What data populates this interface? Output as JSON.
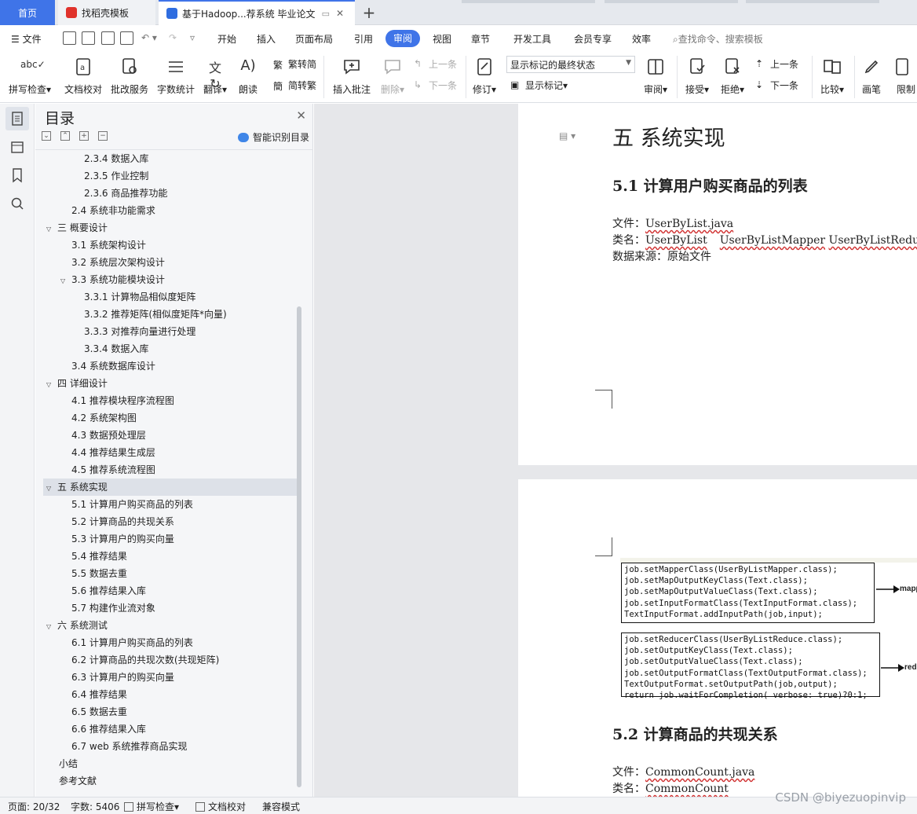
{
  "tabs": [
    {
      "label": "首页"
    },
    {
      "label": "找稻壳模板"
    },
    {
      "label": "基于Hadoop...荐系统 毕业论文"
    }
  ],
  "menu": {
    "file": "文件",
    "items": [
      "开始",
      "插入",
      "页面布局",
      "引用",
      "审阅",
      "视图",
      "章节",
      "开发工具",
      "会员专享",
      "效率"
    ],
    "active": "审阅",
    "search_placeholder": "查找命令、搜索模板"
  },
  "ribbon": {
    "spell": "拼写检查",
    "proof": "文档校对",
    "batch": "批改服务",
    "wordcount": "字数统计",
    "translate": "翻译",
    "read": "朗读",
    "trad": "繁转简",
    "simp": "简转繁",
    "comment": "插入批注",
    "delete": "删除",
    "prev_comment": "上一条",
    "next_comment": "下一条",
    "revise": "修订",
    "markup_state": "显示标记的最终状态",
    "show_markup": "显示标记",
    "review": "审阅",
    "accept": "接受",
    "reject": "拒绝",
    "prev": "上一条",
    "next": "下一条",
    "compare": "比较",
    "pen": "画笔",
    "restrict": "限制"
  },
  "toc": {
    "title": "目录",
    "smart": "智能识别目录",
    "items": [
      {
        "label": "2.3.4  数据入库",
        "level": 3,
        "arrow": ""
      },
      {
        "label": "2.3.5  作业控制",
        "level": 3,
        "arrow": ""
      },
      {
        "label": "2.3.6 商品推荐功能",
        "level": 3,
        "arrow": ""
      },
      {
        "label": "2.4  系统非功能需求",
        "level": 2,
        "arrow": ""
      },
      {
        "label": "三  概要设计",
        "level": 1,
        "arrow": "v"
      },
      {
        "label": "3.1 系统架构设计",
        "level": 2,
        "arrow": ""
      },
      {
        "label": "3.2 系统层次架构设计",
        "level": 2,
        "arrow": ""
      },
      {
        "label": "3.3 系统功能模块设计",
        "level": 2,
        "arrow": "v"
      },
      {
        "label": "3.3.1  计算物品相似度矩阵",
        "level": 3,
        "arrow": ""
      },
      {
        "label": "3.3.2 推荐矩阵(相似度矩阵*向量)",
        "level": 3,
        "arrow": ""
      },
      {
        "label": "3.3.3 对推荐向量进行处理",
        "level": 3,
        "arrow": ""
      },
      {
        "label": "3.3.4 数据入库",
        "level": 3,
        "arrow": ""
      },
      {
        "label": "3.4 系统数据库设计",
        "level": 2,
        "arrow": ""
      },
      {
        "label": "四  详细设计",
        "level": 1,
        "arrow": "v"
      },
      {
        "label": "4.1 推荐模块程序流程图",
        "level": 2,
        "arrow": ""
      },
      {
        "label": "4.2 系统架构图",
        "level": 2,
        "arrow": ""
      },
      {
        "label": "4.3 数据预处理层",
        "level": 2,
        "arrow": ""
      },
      {
        "label": "4.4 推荐结果生成层",
        "level": 2,
        "arrow": ""
      },
      {
        "label": "4.5 推荐系统流程图",
        "level": 2,
        "arrow": ""
      },
      {
        "label": "五  系统实现",
        "level": 1,
        "arrow": "v",
        "selected": true
      },
      {
        "label": "5.1 计算用户购买商品的列表",
        "level": 2,
        "arrow": ""
      },
      {
        "label": "5.2 计算商品的共现关系",
        "level": 2,
        "arrow": ""
      },
      {
        "label": "5.3 计算用户的购买向量",
        "level": 2,
        "arrow": ""
      },
      {
        "label": "5.4 推荐结果",
        "level": 2,
        "arrow": ""
      },
      {
        "label": "5.5 数据去重",
        "level": 2,
        "arrow": ""
      },
      {
        "label": "5.6 推荐结果入库",
        "level": 2,
        "arrow": ""
      },
      {
        "label": "5.7 构建作业流对象",
        "level": 2,
        "arrow": ""
      },
      {
        "label": "六  系统测试",
        "level": 1,
        "arrow": "v"
      },
      {
        "label": "6.1 计算用户购买商品的列表",
        "level": 2,
        "arrow": ""
      },
      {
        "label": "6.2 计算商品的共现次数(共现矩阵)",
        "level": 2,
        "arrow": ""
      },
      {
        "label": "6.3 计算用户的购买向量",
        "level": 2,
        "arrow": ""
      },
      {
        "label": "6.4 推荐结果",
        "level": 2,
        "arrow": ""
      },
      {
        "label": "6.5 数据去重",
        "level": 2,
        "arrow": ""
      },
      {
        "label": "6.6 推荐结果入库",
        "level": 2,
        "arrow": ""
      },
      {
        "label": "6.7 web 系统推荐商品实现",
        "level": 2,
        "arrow": ""
      },
      {
        "label": "小结",
        "level": 0,
        "arrow": ""
      },
      {
        "label": "参考文献",
        "level": 0,
        "arrow": ""
      }
    ]
  },
  "doc": {
    "chapter_title": "五  系统实现",
    "s51_title": "5.1 计算用户购买商品的列表",
    "s51_file_label": "文件：",
    "s51_file": "UserByList.java",
    "s51_class_label": "类名：",
    "s51_class1": "UserByList",
    "s51_class2": "UserByListMapper",
    "s51_class3": "UserByListReducer",
    "s51_source": "数据来源：原始文件",
    "code1": [
      "job.setMapperClass(UserByListMapper.class);",
      "job.setMapOutputKeyClass(Text.class);",
      "job.setMapOutputValueClass(Text.class);",
      "job.setInputFormatClass(TextInputFormat.class);",
      "TextInputFormat.addInputPath(job,input);"
    ],
    "code2": [
      "job.setReducerClass(UserByListReduce.class);",
      "job.setOutputKeyClass(Text.class);",
      "job.setOutputValueClass(Text.class);",
      "job.setOutputFormatClass(TextOutputFormat.class);",
      "TextOutputFormat.setOutputPath(job,output);",
      "return job.waitForCompletion( verbose: true)?0:1;"
    ],
    "arrow1_label": "mapp",
    "arrow2_label": "redu",
    "s52_title": "5.2 计算商品的共现关系",
    "s52_file_label": "文件：",
    "s52_file": "CommonCount.java",
    "s52_class_label": "类名：",
    "s52_class": "CommonCount"
  },
  "status": {
    "page": "页面: 20/32",
    "words": "字数: 5406",
    "spell": "拼写检查",
    "proof": "文档校对",
    "compat": "兼容模式"
  },
  "watermark": "CSDN @biyezuopinvip",
  "colors": {
    "accent": "#3f74e8",
    "wavy": "#d03030"
  }
}
